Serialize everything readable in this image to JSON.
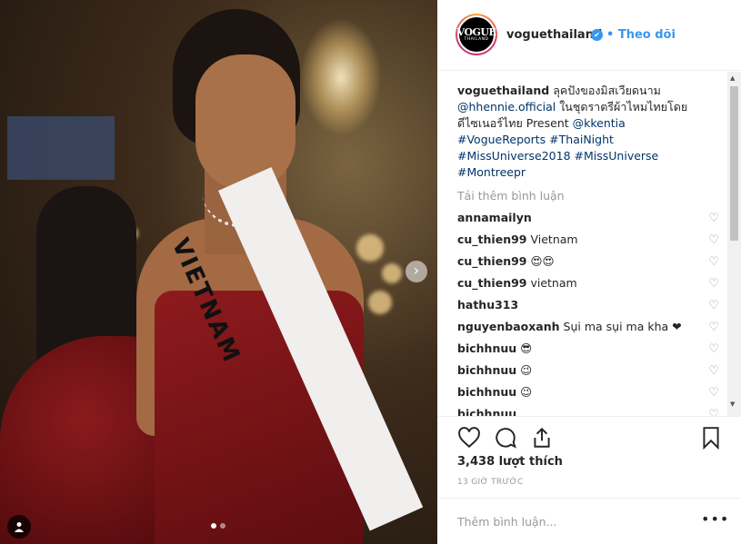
{
  "post": {
    "sash_text": "VIETNAM",
    "nav_arrow": "›",
    "tag_icon": "person-icon"
  },
  "header": {
    "avatar_logo": "VOGUE",
    "avatar_sub": "THAILAND",
    "username": "voguethailand",
    "follow_label": "• Theo dõi"
  },
  "caption": {
    "username": "voguethailand",
    "text_1": " ลุคปังของมิสเวียดนาม",
    "mention_1": "@hhennie.official",
    "text_2": " ในชุดราตรีผ้าไหมไทยโดยดีไซเนอร์ไทย Present ",
    "mention_2": "@kkentia",
    "hashtags_1": "#VogueReports #ThaiNight",
    "hashtags_2": "#MissUniverse2018 #MissUniverse",
    "hashtags_3": "#Montreepr"
  },
  "load_more": "Tải thêm bình luận",
  "comments": [
    {
      "user": "annamailyn",
      "text": " "
    },
    {
      "user": "cu_thien99",
      "text": " Vietnam "
    },
    {
      "user": "cu_thien99",
      "text": " 😍😍"
    },
    {
      "user": "cu_thien99",
      "text": " vietnam"
    },
    {
      "user": "hathu313",
      "text": " "
    },
    {
      "user": "nguyenbaoxanh",
      "text": " Sụi ma sụi ma kha ❤"
    },
    {
      "user": "bichhnuu",
      "text": " 😎"
    },
    {
      "user": "bichhnuu",
      "text": " 😉"
    },
    {
      "user": "bichhnuu",
      "text": " 😉"
    },
    {
      "user": "bichhnuu",
      "text": ""
    }
  ],
  "actions": {
    "like_icon": "heart-icon",
    "comment_icon": "comment-icon",
    "share_icon": "share-icon",
    "save_icon": "bookmark-icon"
  },
  "likes": "3,438 lượt thích",
  "timestamp": "13 GIỜ TRƯỚC",
  "comment_placeholder": "Thêm bình luận...",
  "more_label": "•••",
  "colors": {
    "link": "#003569",
    "follow": "#3897f0",
    "muted": "#999999"
  }
}
